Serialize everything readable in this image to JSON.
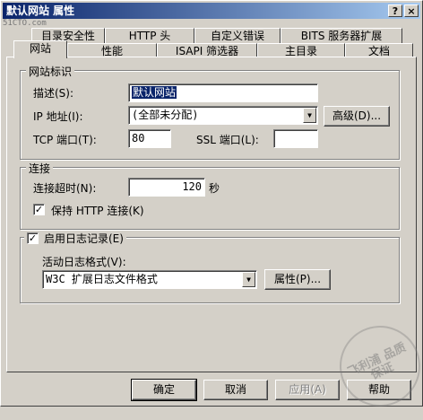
{
  "window": {
    "title": "默认网站 属性",
    "help_button": "?",
    "close_button": "×",
    "watermark": "51CTO.com"
  },
  "tabs_row1": [
    {
      "label": "目录安全性"
    },
    {
      "label": "HTTP 头"
    },
    {
      "label": "自定义错误"
    },
    {
      "label": "BITS 服务器扩展"
    }
  ],
  "tabs_row2": [
    {
      "label": "网站",
      "active": true
    },
    {
      "label": "性能"
    },
    {
      "label": "ISAPI 筛选器"
    },
    {
      "label": "主目录"
    },
    {
      "label": "文档"
    }
  ],
  "site_id": {
    "legend": "网站标识",
    "description_label": "描述(S):",
    "description_value": "默认网站",
    "ip_label": "IP 地址(I):",
    "ip_value": "(全部未分配)",
    "advanced_button": "高级(D)...",
    "tcp_label": "TCP 端口(T):",
    "tcp_value": "80",
    "ssl_label": "SSL 端口(L):",
    "ssl_value": ""
  },
  "connections": {
    "legend": "连接",
    "timeout_label": "连接超时(N):",
    "timeout_value": "120",
    "timeout_unit": "秒",
    "keepalive_label": "保持 HTTP 连接(K)",
    "keepalive_checked": true
  },
  "logging": {
    "enable_label": "启用日志记录(E)",
    "enable_checked": true,
    "format_label": "活动日志格式(V):",
    "format_value": "W3C 扩展日志文件格式",
    "properties_button": "属性(P)..."
  },
  "footer": {
    "ok": "确定",
    "cancel": "取消",
    "apply": "应用(A)",
    "help": "帮助"
  },
  "stamp_text": "飞利浦 品质 保证"
}
